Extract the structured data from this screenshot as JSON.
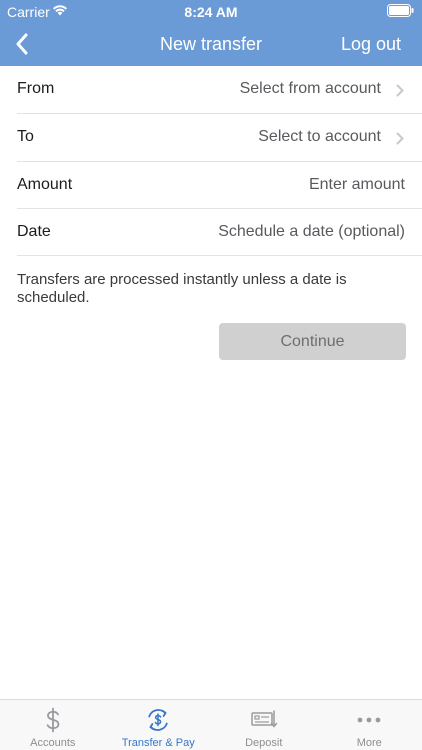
{
  "status_bar": {
    "carrier": "Carrier",
    "time": "8:24 AM"
  },
  "nav": {
    "title": "New transfer",
    "logout_label": "Log out",
    "back_icon": "chevron-left-icon"
  },
  "form": {
    "rows": [
      {
        "label": "From",
        "value": "Select from account",
        "has_chevron": true
      },
      {
        "label": "To",
        "value": "Select to account",
        "has_chevron": true
      },
      {
        "label": "Amount",
        "value": "Enter amount",
        "has_chevron": false
      },
      {
        "label": "Date",
        "value": "Schedule a date (optional)",
        "has_chevron": false
      }
    ]
  },
  "info_text": "Transfers are processed instantly unless a date is scheduled.",
  "continue_label": "Continue",
  "tabs": [
    {
      "label": "Accounts",
      "icon": "dollar-icon",
      "active": false
    },
    {
      "label": "Transfer & Pay",
      "icon": "transfer-pay-icon",
      "active": true
    },
    {
      "label": "Deposit",
      "icon": "deposit-check-icon",
      "active": false
    },
    {
      "label": "More",
      "icon": "more-icon",
      "active": false
    }
  ],
  "colors": {
    "header": "#6a9bd6",
    "active_tab": "#3677c8",
    "inactive_tab": "#8e8e93",
    "button_disabled": "#d0d0d0"
  }
}
